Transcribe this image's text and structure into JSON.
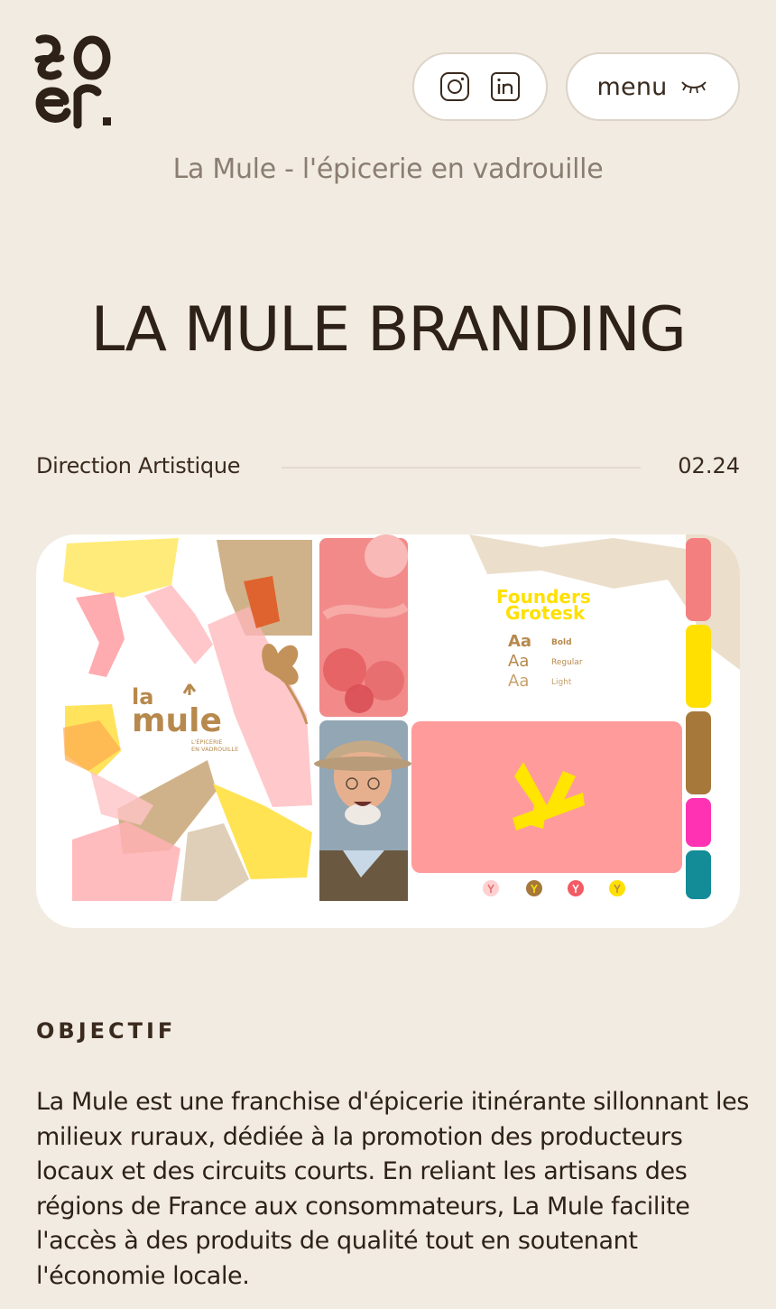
{
  "header": {
    "logo_text": "yo er.",
    "social": [
      {
        "icon": "instagram-icon"
      },
      {
        "icon": "linkedin-icon"
      }
    ],
    "menu": {
      "label": "menu",
      "icon": "closed-eye-icon"
    }
  },
  "project": {
    "subtitle": "La Mule - l'épicerie en vadrouille",
    "title": "LA MULE BRANDING",
    "category": "Direction Artistique",
    "date": "02.24"
  },
  "hero": {
    "brand_la": "la",
    "brand_name": "mule",
    "brand_tagline_1": "L'ÉPICERIE",
    "brand_tagline_2": "EN VADROUILLE",
    "font_name_1": "Founders",
    "font_name_2": "Grotesk",
    "weights": [
      {
        "sample": "Aa",
        "name": "Bold"
      },
      {
        "sample": "Aa",
        "name": "Regular"
      },
      {
        "sample": "Aa",
        "name": "Light"
      }
    ],
    "palette": [
      "#f47f7f",
      "#ffe000",
      "#a6783a",
      "#ff32b4",
      "#138c98"
    ],
    "accent_colors": {
      "pink": "#ff9b9b",
      "yellow": "#ffe500",
      "tan": "#c9a06c",
      "sand": "#ebdfcc"
    }
  },
  "content": {
    "section_label": "OBJECTIF",
    "body": "La Mule est une franchise d'épicerie itinérante sillonnant les milieux ruraux, dédiée à la promotion des producteurs locaux et des circuits courts. En reliant les artisans des régions de France aux consommateurs, La Mule facilite l'accès à des produits de qualité tout en soutenant l'économie locale."
  }
}
